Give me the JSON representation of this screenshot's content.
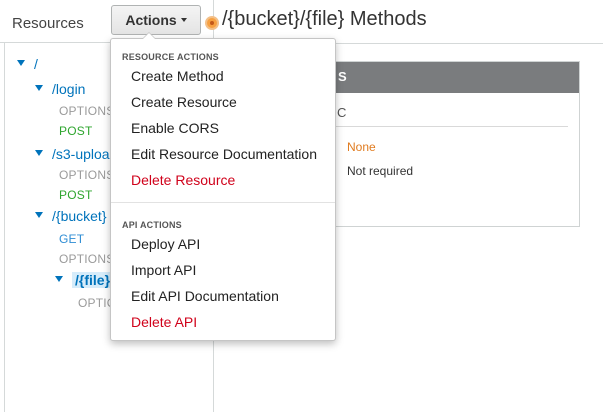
{
  "sidebar": {
    "title": "Resources",
    "tree": {
      "root": "/",
      "login": "/login",
      "login_options": "OPTIONS",
      "login_post": "POST",
      "s3upload": "/s3-uploa",
      "s3upload_options": "OPTIONS",
      "s3upload_post": "POST",
      "bucket": "/{bucket}",
      "bucket_get": "GET",
      "bucket_options": "OPTIONS",
      "file": "/{file}",
      "file_options": "OPTIO"
    }
  },
  "header": {
    "actions_label": "Actions",
    "title": "/{bucket}/{file} Methods"
  },
  "actions_menu": {
    "resource_section": "RESOURCE ACTIONS",
    "resource_items": [
      "Create Method",
      "Create Resource",
      "Enable CORS",
      "Edit Resource Documentation",
      "Delete Resource"
    ],
    "api_section": "API ACTIONS",
    "api_items": [
      "Deploy API",
      "Import API",
      "Edit API Documentation",
      "Delete API"
    ]
  },
  "detail": {
    "header_fragment": "S",
    "row_fragment": "C",
    "authorization_value": "None",
    "api_key_value": "Not required"
  },
  "colors": {
    "link": "#0073bb",
    "post": "#2ea52e",
    "get": "#2f8dd4",
    "danger": "#d0021b",
    "warning": "#e07b1f",
    "panel_header": "#7a7c7e"
  }
}
